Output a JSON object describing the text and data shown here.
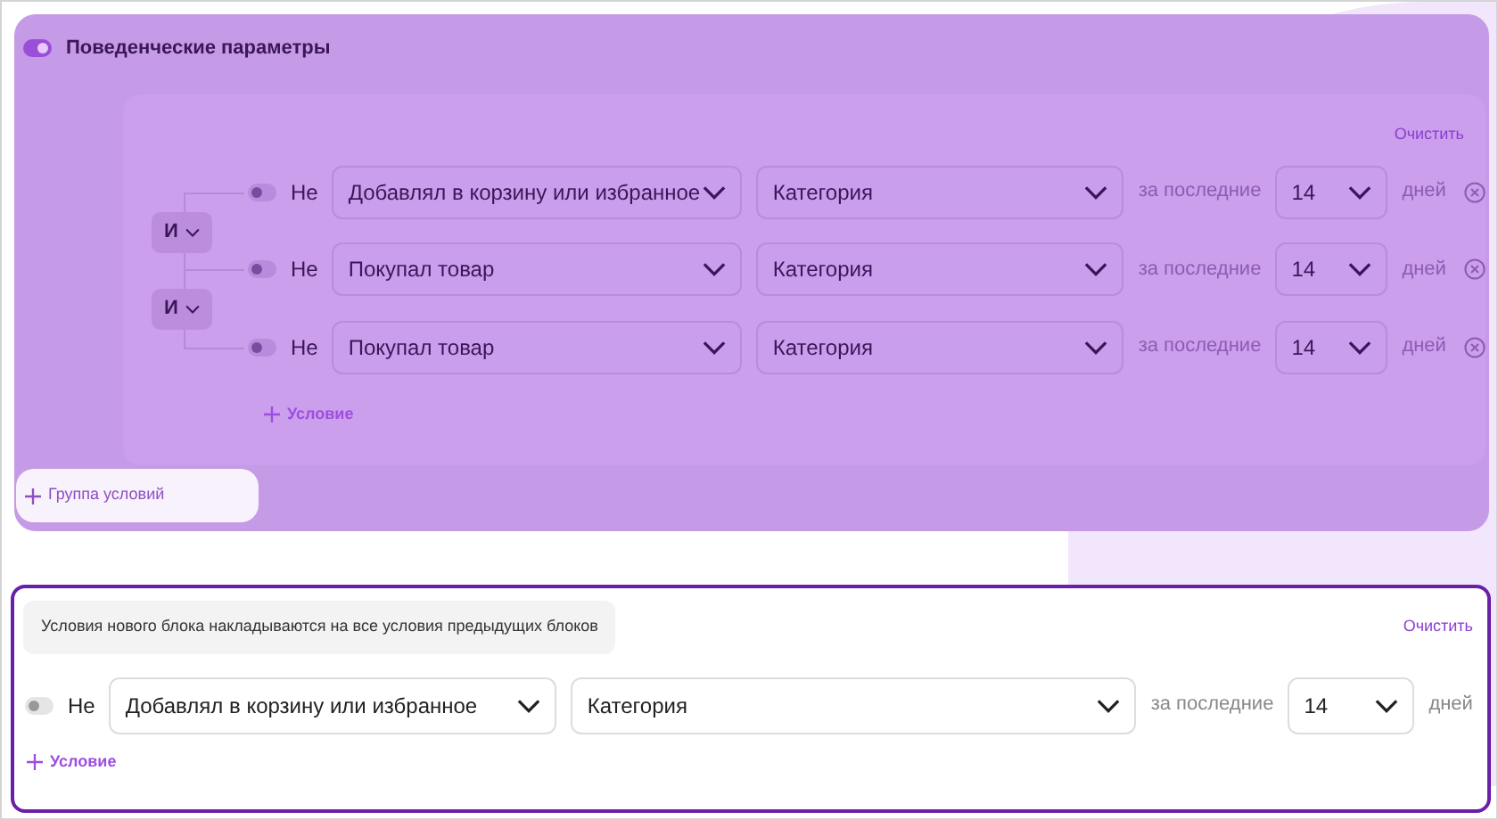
{
  "behavior_block": {
    "title": "Поведенческие параметры",
    "enabled": true,
    "clear_link": "Очистить",
    "operators": [
      {
        "label": "И"
      },
      {
        "label": "И"
      }
    ],
    "conditions": [
      {
        "negate_label": "Не",
        "negate": false,
        "action": "Добавлял в корзину или избранное",
        "category": "Категория",
        "period_label": "за последние",
        "days": "14",
        "days_label": "дней"
      },
      {
        "negate_label": "Не",
        "negate": false,
        "action": "Покупал товар",
        "category": "Категория",
        "period_label": "за последние",
        "days": "14",
        "days_label": "дней"
      },
      {
        "negate_label": "Не",
        "negate": false,
        "action": "Покупал товар",
        "category": "Категория",
        "period_label": "за последние",
        "days": "14",
        "days_label": "дней"
      }
    ],
    "add_condition": "Условие",
    "add_group": "Группа условий"
  },
  "new_block": {
    "note": "Условия нового блока накладываются на все условия предыдущих блоков",
    "clear_link": "Очистить",
    "conditions": [
      {
        "negate_label": "Не",
        "negate": false,
        "action": "Добавлял в корзину или избранное",
        "category": "Категория",
        "period_label": "за последние",
        "days": "14",
        "days_label": "дней"
      }
    ],
    "add_condition": "Условие"
  }
}
